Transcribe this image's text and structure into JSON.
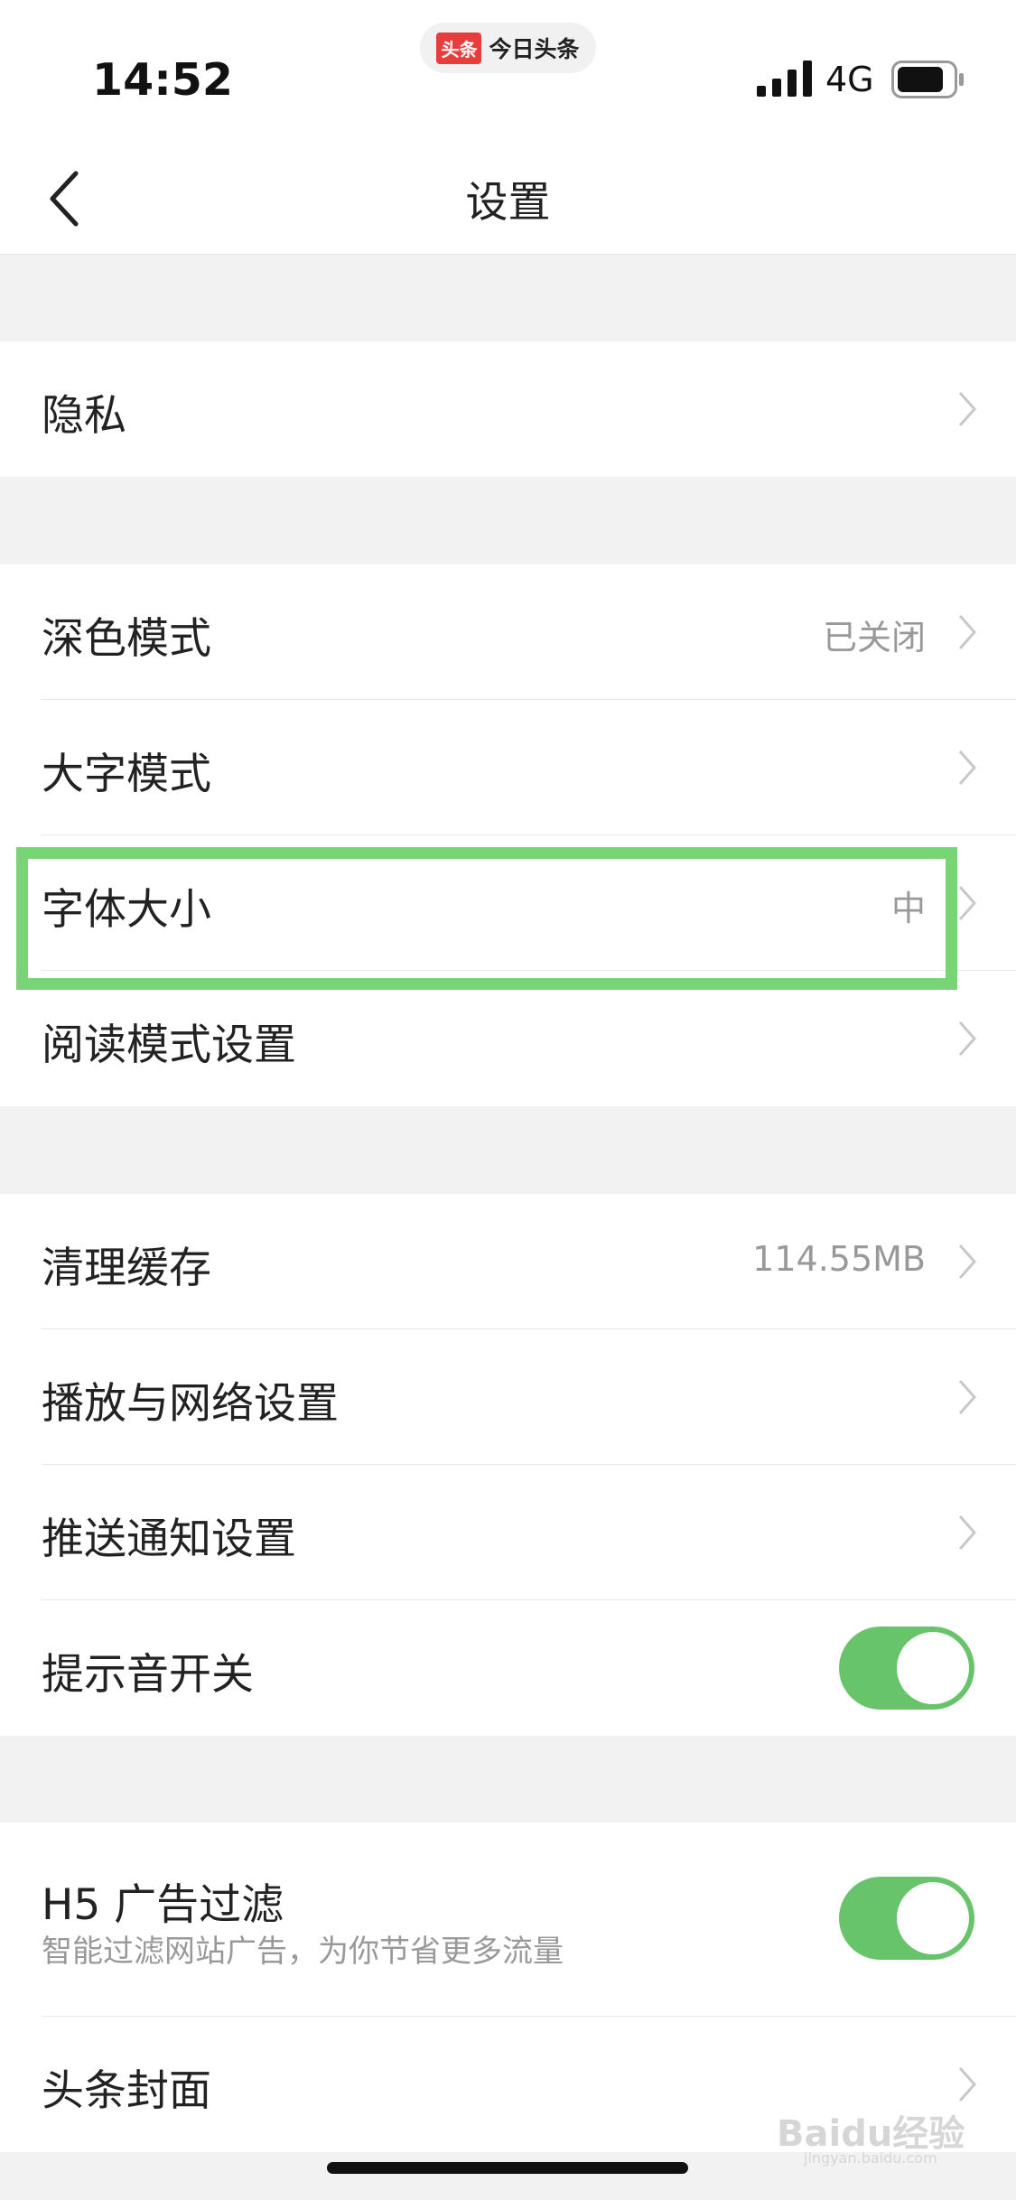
{
  "status_bar": {
    "time": "14:52",
    "app_logo": "头条",
    "app_name": "今日头条",
    "network": "4G"
  },
  "nav": {
    "title": "设置",
    "back_icon": "chevron-left-icon"
  },
  "groups": [
    {
      "items": [
        {
          "label": "隐私",
          "value": ""
        }
      ]
    },
    {
      "items": [
        {
          "label": "深色模式",
          "value": "已关闭"
        },
        {
          "label": "大字模式",
          "value": ""
        },
        {
          "label": "字体大小",
          "value": "中"
        },
        {
          "label": "阅读模式设置",
          "value": ""
        }
      ]
    },
    {
      "items": [
        {
          "label": "清理缓存",
          "value": "114.55MB"
        },
        {
          "label": "播放与网络设置",
          "value": ""
        },
        {
          "label": "推送通知设置",
          "value": ""
        },
        {
          "label": "提示音开关",
          "toggle": true
        }
      ]
    },
    {
      "items": [
        {
          "label": "H5 广告过滤",
          "sublabel": "智能过滤网站广告，为你节省更多流量",
          "toggle": true
        },
        {
          "label": "头条封面",
          "value": ""
        }
      ]
    }
  ],
  "colors": {
    "toggle_on": "#68c46a",
    "highlight": "#79d475",
    "background": "#f2f2f2"
  },
  "watermark": {
    "text": "Baidu经验",
    "sub": "jingyan.baidu.com"
  }
}
